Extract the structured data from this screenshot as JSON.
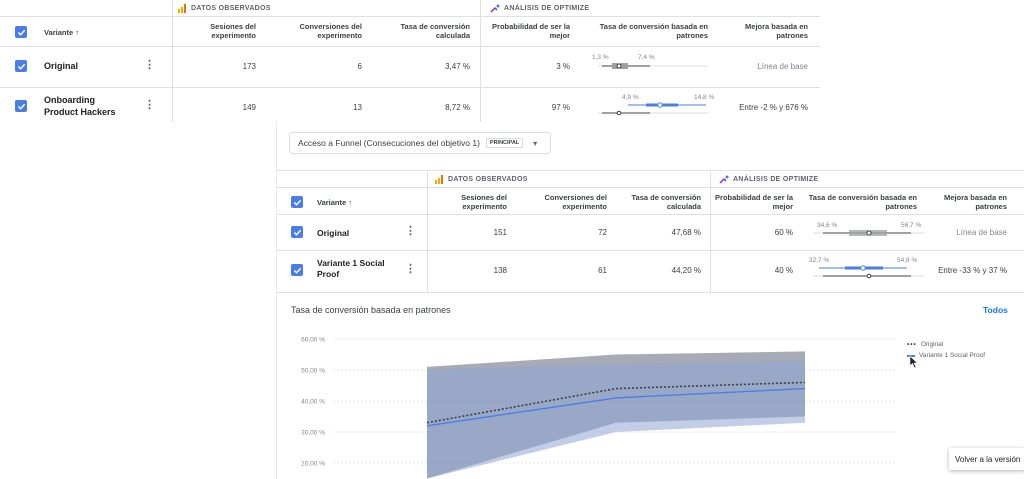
{
  "top": {
    "observed_header": "DATOS OBSERVADOS",
    "optimize_header": "ANÁLISIS DE OPTIMIZE",
    "columns": {
      "variant": "Variante ↑",
      "sessions": "Sesiones del experimento",
      "conversions": "Conversiones del experimento",
      "rate": "Tasa de conversión calculada",
      "prob": "Probabilidad de ser la mejor",
      "model_rate": "Tasa de conversión basada en patrones",
      "improvement": "Mejora basada en patrones"
    },
    "rows": [
      {
        "name": "Original",
        "sessions": "173",
        "conversions": "6",
        "rate": "3,47 %",
        "prob": "3 %",
        "ci_low": "1,3 %",
        "ci_high": "7,4 %",
        "improvement": "Línea de base"
      },
      {
        "name": "Onboarding Product Hackers",
        "sessions": "149",
        "conversions": "13",
        "rate": "8,72 %",
        "prob": "97 %",
        "ci_low": "4,9 %",
        "ci_high": "14,8 %",
        "improvement": "Entre -2 % y 676 %"
      }
    ]
  },
  "bottom": {
    "objective": "Acceso a Funnel (Consecuciones del objetivo 1)",
    "badge": "PRINCIPAL",
    "observed_header": "DATOS OBSERVADOS",
    "optimize_header": "ANÁLISIS DE OPTIMIZE",
    "columns": {
      "variant": "Variante ↑",
      "sessions": "Sesiones del experimento",
      "conversions": "Conversiones del experimento",
      "rate": "Tasa de conversión calculada",
      "prob": "Probabilidad de ser la mejor",
      "model_rate": "Tasa de conversión basada en patrones",
      "improvement": "Mejora basada en patrones"
    },
    "rows": [
      {
        "name": "Original",
        "sessions": "151",
        "conversions": "72",
        "rate": "47,68 %",
        "prob": "60 %",
        "ci_low": "34,6 %",
        "ci_high": "56,7 %",
        "improvement": "Línea de base"
      },
      {
        "name": "Variante 1 Social Proof",
        "sessions": "138",
        "conversions": "61",
        "rate": "44,20 %",
        "prob": "40 %",
        "ci_low": "32,7 %",
        "ci_high": "54,8 %",
        "improvement": "Entre -33 % y 37 %"
      }
    ],
    "chart_title": "Tasa de conversión basada en patrones",
    "all_link": "Todos",
    "tooltip": "Volver a la versión"
  },
  "colors": {
    "accent": "#4a7ee6",
    "link": "#1a73e8",
    "band_grey": "#8a8f9c",
    "band_blue": "#8fa6d6"
  },
  "chart_data": {
    "type": "line",
    "title": "Tasa de conversión basada en patrones",
    "yticks": [
      "60,00 %",
      "50,00 %",
      "40,00 %",
      "30,00 %",
      "20,00 %"
    ],
    "ylim": [
      20,
      60
    ],
    "series": [
      {
        "name": "Original",
        "values": [
          33,
          44,
          46
        ],
        "low": [
          15,
          33,
          35
        ],
        "high": [
          51,
          55,
          56
        ],
        "style": "dotted"
      },
      {
        "name": "Variante 1 Social Proof",
        "values": [
          32,
          41,
          44
        ],
        "low": [
          15,
          30,
          33
        ],
        "high": [
          50,
          52,
          53
        ],
        "style": "solid"
      }
    ]
  }
}
